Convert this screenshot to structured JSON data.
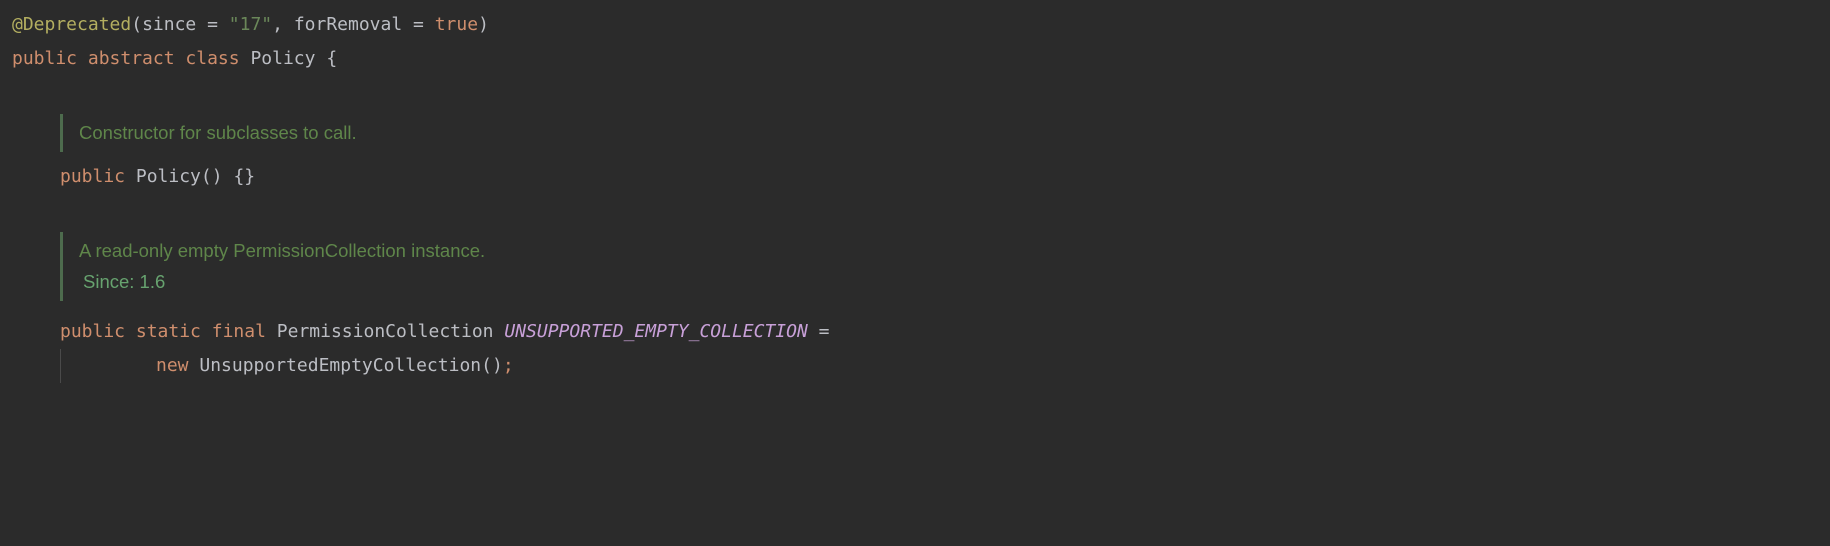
{
  "code": {
    "line1": {
      "annotation": "@Deprecated",
      "lparen": "(",
      "p1name": "since",
      "eq1": " = ",
      "p1val": "\"17\"",
      "comma": ", ",
      "p2name": "forRemoval",
      "eq2": " = ",
      "p2val": "true",
      "rparen": ")"
    },
    "line2": {
      "kw_public": "public",
      "sp1": " ",
      "kw_abstract": "abstract",
      "sp2": " ",
      "kw_class": "class",
      "sp3": " ",
      "classname": "Policy",
      "sp4": " ",
      "lbrace": "{"
    },
    "doc1": {
      "text": "Constructor for subclasses to call."
    },
    "line3": {
      "kw_public": "public",
      "sp1": " ",
      "ctor": "Policy",
      "parens": "()",
      "sp2": " ",
      "braces": "{}"
    },
    "doc2": {
      "text": "A read-only empty PermissionCollection instance.",
      "since": "Since: 1.6"
    },
    "line4": {
      "kw_public": "public",
      "sp1": " ",
      "kw_static": "static",
      "sp2": " ",
      "kw_final": "final",
      "sp3": " ",
      "type": "PermissionCollection",
      "sp4": " ",
      "constname": "UNSUPPORTED_EMPTY_COLLECTION",
      "sp5": " ",
      "eq": "="
    },
    "line5": {
      "kw_new": "new",
      "sp1": " ",
      "type": "UnsupportedEmptyCollection",
      "parens": "()",
      "semi": ";"
    }
  }
}
